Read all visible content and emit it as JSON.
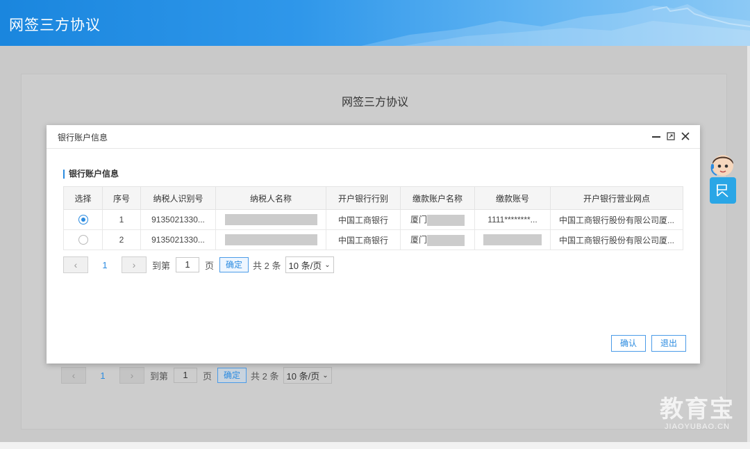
{
  "header": {
    "app_title": "网签三方协议"
  },
  "page": {
    "title": "网签三方协议",
    "pager": {
      "prev": "<",
      "page": "1",
      "next": ">",
      "goto_prefix": "到第",
      "goto_value": "1",
      "goto_suffix": "页",
      "confirm": "确定",
      "total": "共 2 条",
      "page_size": "10 条/页"
    }
  },
  "modal": {
    "title": "银行账户信息",
    "section_title": "银行账户信息",
    "columns": [
      "选择",
      "序号",
      "纳税人识别号",
      "纳税人名称",
      "开户银行行别",
      "缴款账户名称",
      "缴款账号",
      "开户银行营业网点"
    ],
    "rows": [
      {
        "selected": true,
        "index": "1",
        "tax_id": "9135021330...",
        "bank_type": "中国工商银行",
        "account_name": "厦门",
        "account_no": "1111********...",
        "branch": "中国工商银行股份有限公司厦..."
      },
      {
        "selected": false,
        "index": "2",
        "tax_id": "9135021330...",
        "bank_type": "中国工商银行",
        "account_name": "厦门",
        "account_no": "",
        "branch": "中国工商银行股份有限公司厦..."
      }
    ],
    "pager": {
      "prev": "<",
      "page": "1",
      "next": ">",
      "goto_prefix": "到第",
      "goto_value": "1",
      "goto_suffix": "页",
      "confirm": "确定",
      "total": "共 2 条",
      "page_size": "10 条/页"
    },
    "confirm_button": "确认",
    "exit_button": "退出"
  },
  "watermark": {
    "brand": "教育宝",
    "domain": "JIAOYUBAO.CN"
  },
  "colors": {
    "accent": "#2b8be0",
    "header": "#1a86de",
    "help_button": "#2aa6e6"
  },
  "icons": [
    "minimize-icon",
    "maximize-icon",
    "close-icon",
    "chevron-left-icon",
    "chevron-right-icon",
    "chevron-down-icon",
    "help-icon"
  ]
}
